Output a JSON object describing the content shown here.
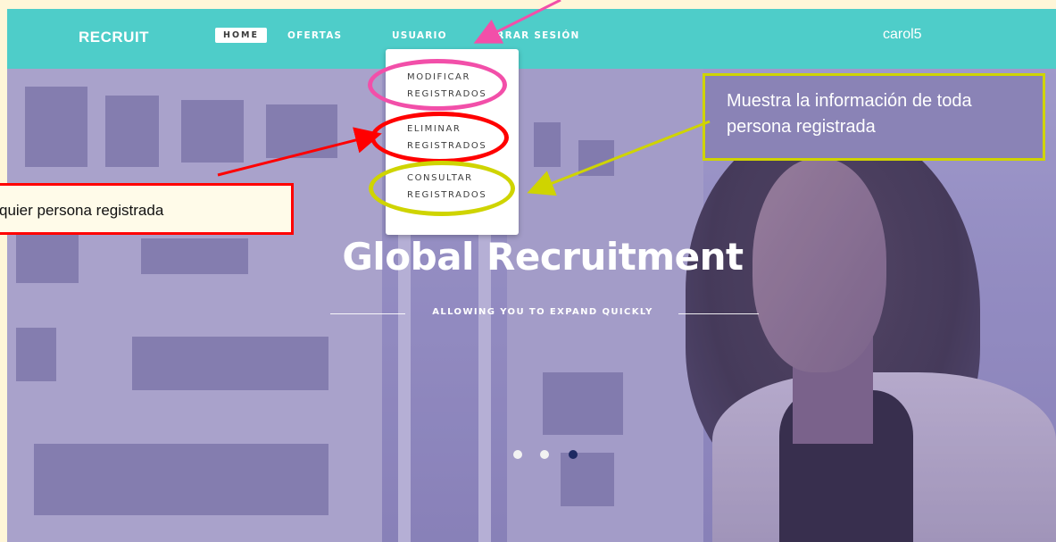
{
  "navbar": {
    "brand": "RECRUIT",
    "items": [
      {
        "label": "HOME",
        "active": true
      },
      {
        "label": "OFERTAS"
      },
      {
        "label": "USUARIO"
      },
      {
        "label": "CERRAR SESIÓN"
      }
    ],
    "user": "carol5",
    "bg_color": "#4ecdc9"
  },
  "dropdown": {
    "items": [
      {
        "line1": "MODIFICAR",
        "line2": "REGISTRADOS"
      },
      {
        "line1": "ELIMINAR",
        "line2": "REGISTRADOS"
      },
      {
        "line1": "CONSULTAR",
        "line2": "REGISTRADOS"
      }
    ]
  },
  "hero": {
    "title": "Global Recruitment",
    "subtitle": "ALLOWING YOU TO EXPAND QUICKLY",
    "carousel": {
      "count": 3,
      "active_index": 2
    }
  },
  "annotations": {
    "left_note": "quier persona registrada",
    "right_note": "Muestra la información de toda persona registrada",
    "colors": {
      "pink": "#f24fa9",
      "red": "#ff0000",
      "yellow": "#cfd400"
    }
  }
}
